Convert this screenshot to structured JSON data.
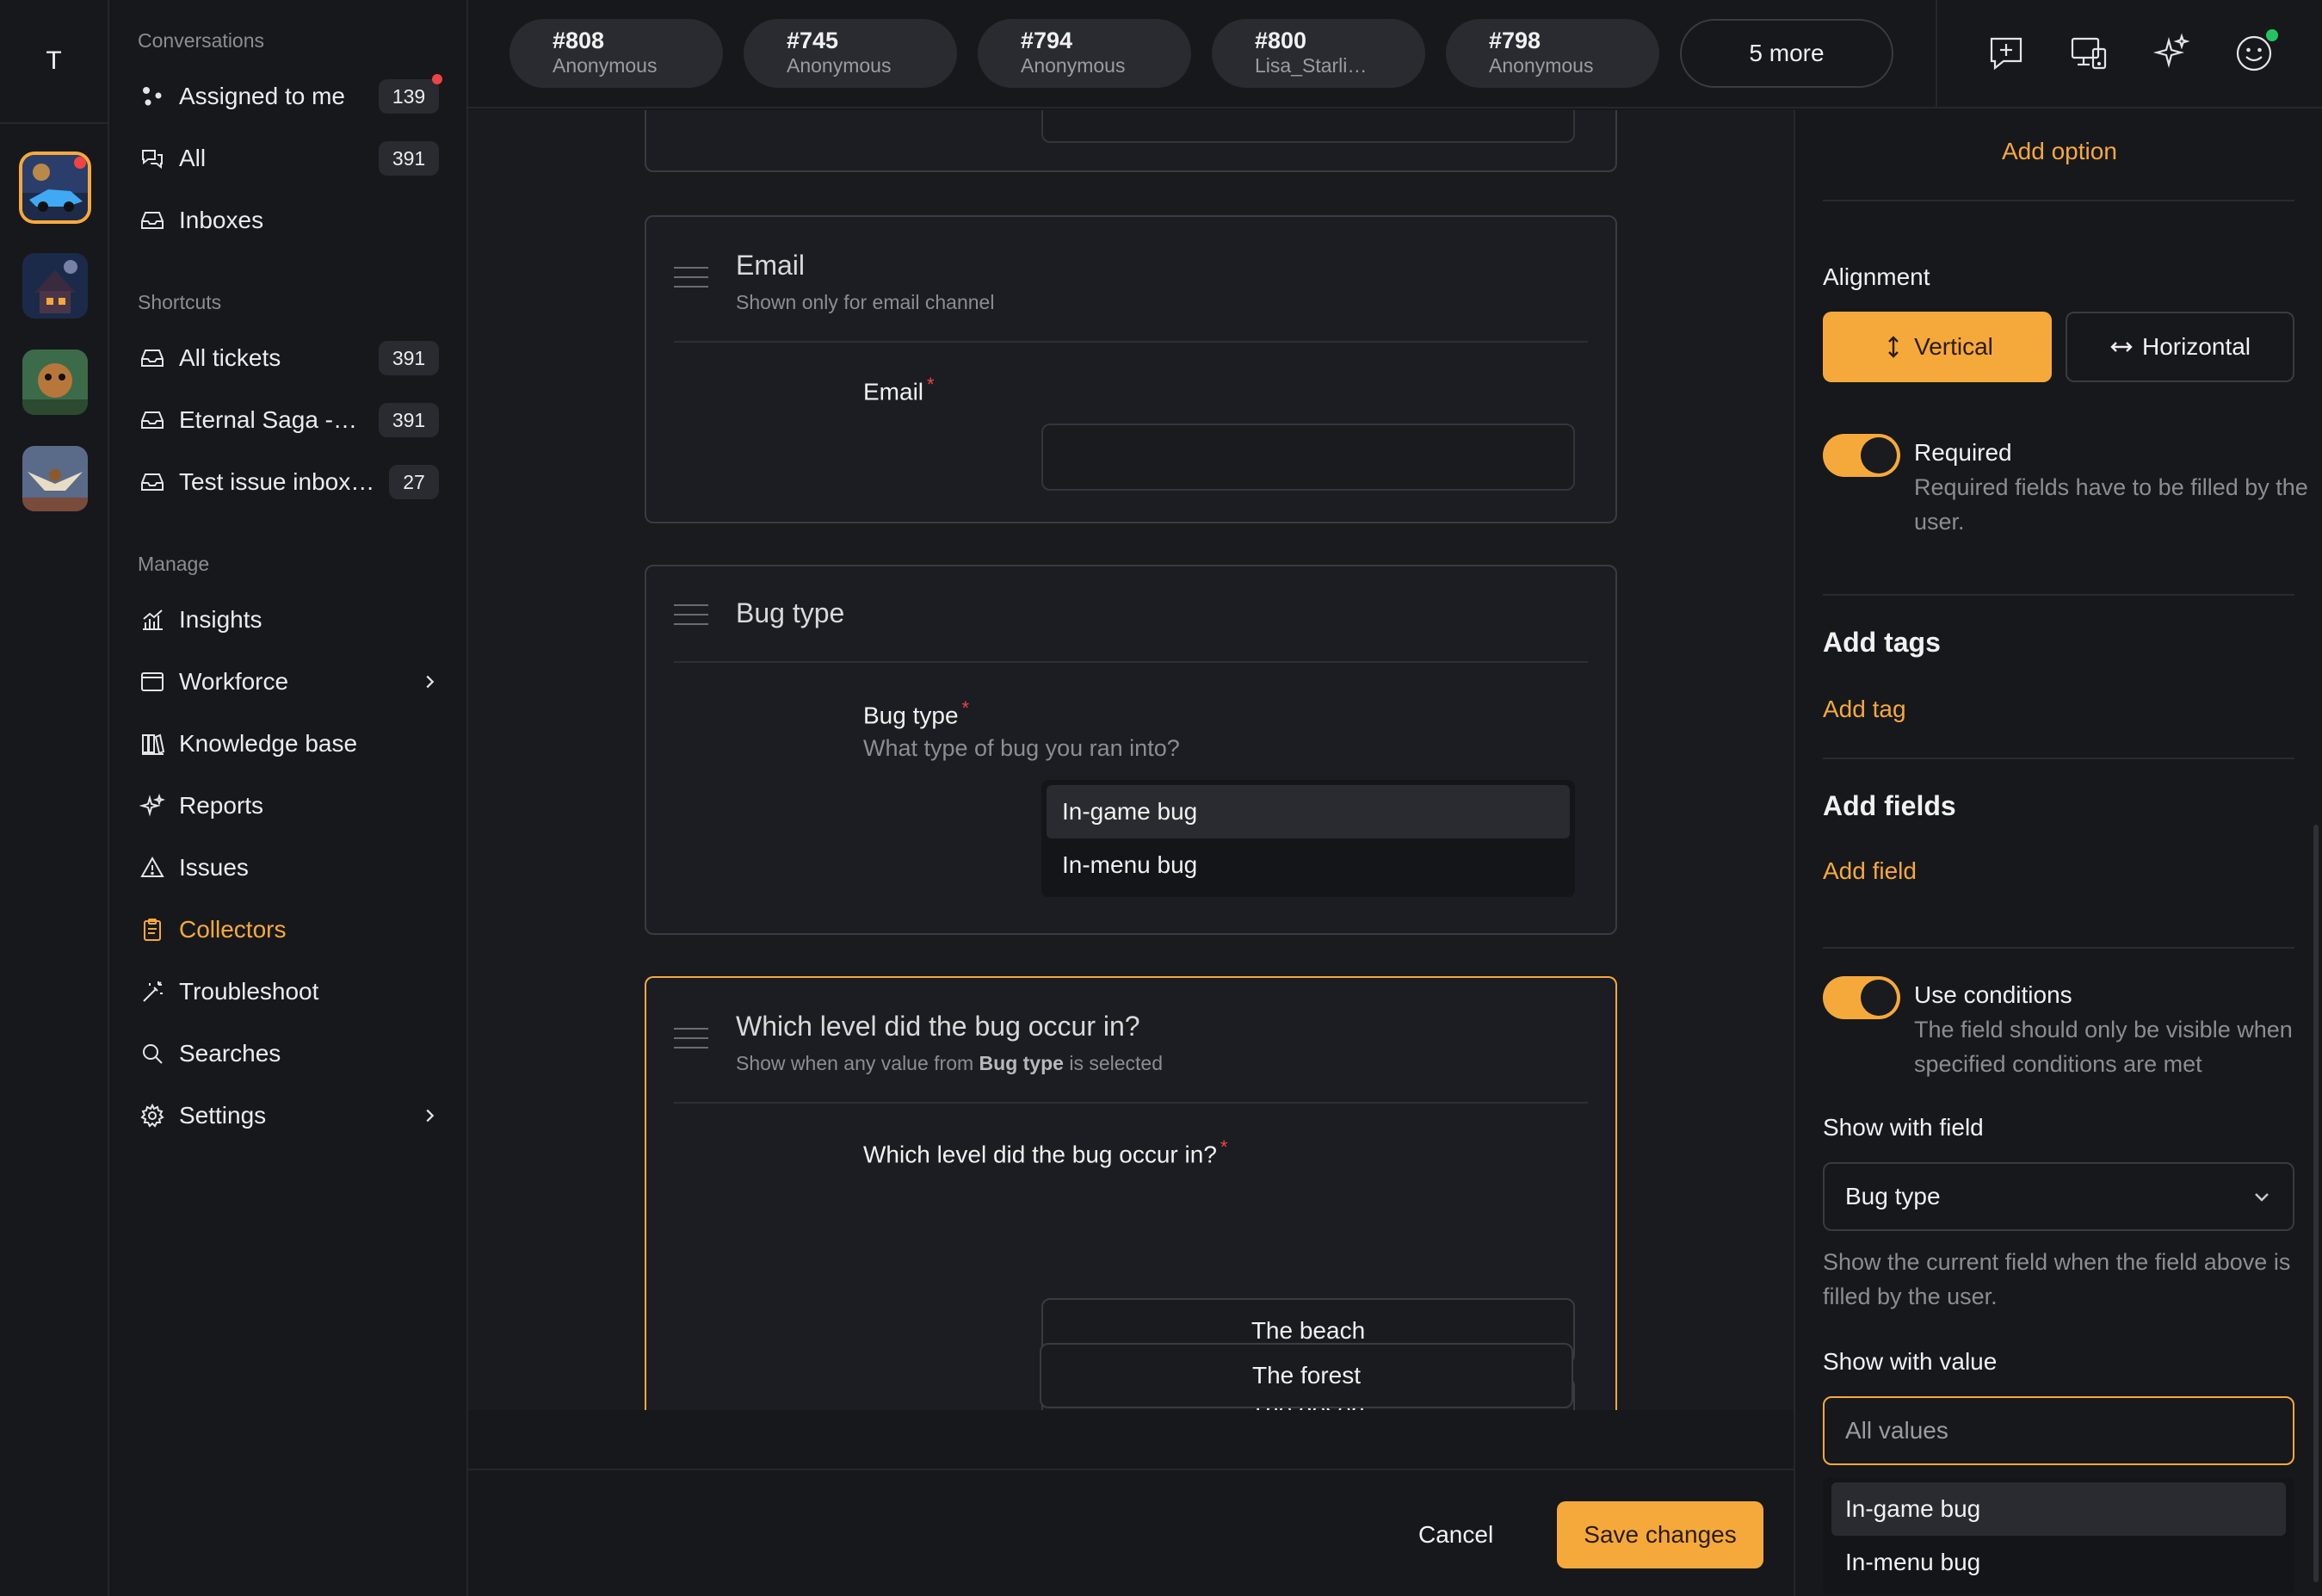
{
  "rail": {
    "workspace_initial": "T"
  },
  "sidebar": {
    "conversations_title": "Conversations",
    "conversations": [
      {
        "label": "Assigned to me",
        "count": "139"
      },
      {
        "label": "All",
        "count": "391"
      },
      {
        "label": "Inboxes",
        "count": ""
      }
    ],
    "shortcuts_title": "Shortcuts",
    "shortcuts": [
      {
        "label": "All tickets",
        "count": "391"
      },
      {
        "label": "Eternal Saga -…",
        "count": "391"
      },
      {
        "label": "Test issue inbox…",
        "count": "27"
      }
    ],
    "manage_title": "Manage",
    "manage": [
      {
        "label": "Insights"
      },
      {
        "label": "Workforce"
      },
      {
        "label": "Knowledge base"
      },
      {
        "label": "Reports"
      },
      {
        "label": "Issues"
      },
      {
        "label": "Collectors"
      },
      {
        "label": "Troubleshoot"
      },
      {
        "label": "Searches"
      },
      {
        "label": "Settings"
      }
    ]
  },
  "tabs": [
    {
      "num": "#808",
      "sub": "Anonymous"
    },
    {
      "num": "#745",
      "sub": "Anonymous"
    },
    {
      "num": "#794",
      "sub": "Anonymous"
    },
    {
      "num": "#800",
      "sub": "Lisa_Starli…"
    },
    {
      "num": "#798",
      "sub": "Anonymous"
    }
  ],
  "tabs_more": "5 more",
  "form": {
    "email_card": {
      "title": "Email",
      "subtitle": "Shown only for email channel",
      "field_label": "Email",
      "required_mark": "*"
    },
    "bugtype_card": {
      "title": "Bug type",
      "field_label": "Bug type",
      "required_mark": "*",
      "help": "What type of bug you ran into?",
      "options": [
        "In-game bug",
        "In-menu bug"
      ]
    },
    "level_card": {
      "title": "Which level did the bug occur in?",
      "subtitle_pre": "Show when any value from ",
      "subtitle_field": "Bug type",
      "subtitle_post": " is selected",
      "field_label": "Which level did the bug occur in?",
      "required_mark": "*",
      "options": [
        "The beach",
        "The desert",
        "The forest"
      ]
    }
  },
  "footer": {
    "cancel": "Cancel",
    "save": "Save changes"
  },
  "panel": {
    "add_option": "Add option",
    "alignment_label": "Alignment",
    "alignment_vertical": "Vertical",
    "alignment_horizontal": "Horizontal",
    "required_label": "Required",
    "required_help": "Required fields have to be filled by the user.",
    "add_tags_title": "Add tags",
    "add_tag": "Add tag",
    "add_fields_title": "Add fields",
    "add_field": "Add field",
    "use_conditions_label": "Use conditions",
    "use_conditions_help": "The field should only be visible when specified conditions are met",
    "show_with_field_label": "Show with field",
    "show_with_field_value": "Bug type",
    "show_with_field_help": "Show the current field when the field above is filled by the user.",
    "show_with_value_label": "Show with value",
    "show_with_value_placeholder": "All values",
    "value_options": [
      "In-game bug",
      "In-menu bug"
    ]
  },
  "colors": {
    "accent": "#f6a93b",
    "background": "#17181c",
    "required": "#ef4444",
    "online": "#22c55e"
  }
}
